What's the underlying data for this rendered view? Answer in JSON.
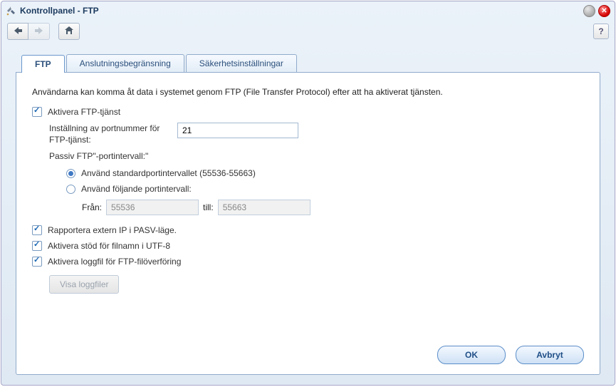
{
  "window": {
    "title": "Kontrollpanel - FTP"
  },
  "tabs": [
    {
      "label": "FTP",
      "active": true
    },
    {
      "label": "Anslutningsbegränsning",
      "active": false
    },
    {
      "label": "Säkerhetsinställningar",
      "active": false
    }
  ],
  "panel": {
    "description": "Användarna kan komma åt data i systemet genom FTP (File Transfer Protocol) efter att ha aktiverat tjänsten.",
    "enable_service": {
      "label": "Aktivera FTP-tjänst",
      "checked": true
    },
    "port": {
      "label": "Inställning av portnummer för FTP-tjänst:",
      "value": "21"
    },
    "passive_title": "Passiv FTP\"-portintervall:\"",
    "port_mode": {
      "default": {
        "label": "Använd standardportintervallet (55536-55663)",
        "selected": true
      },
      "custom": {
        "label": "Använd följande portintervall:",
        "selected": false
      }
    },
    "range": {
      "from_label": "Från:",
      "from_value": "55536",
      "to_label": "till:",
      "to_value": "55663"
    },
    "report_ip": {
      "label": "Rapportera extern IP i PASV-läge.",
      "checked": true
    },
    "utf8": {
      "label": "Aktivera stöd för filnamn i UTF-8",
      "checked": true
    },
    "logfile": {
      "label": "Aktivera loggfil för FTP-filöverföring",
      "checked": true
    },
    "view_logs": {
      "label": "Visa loggfiler"
    }
  },
  "footer": {
    "ok": "OK",
    "cancel": "Avbryt"
  },
  "nav": {
    "help": "?"
  }
}
